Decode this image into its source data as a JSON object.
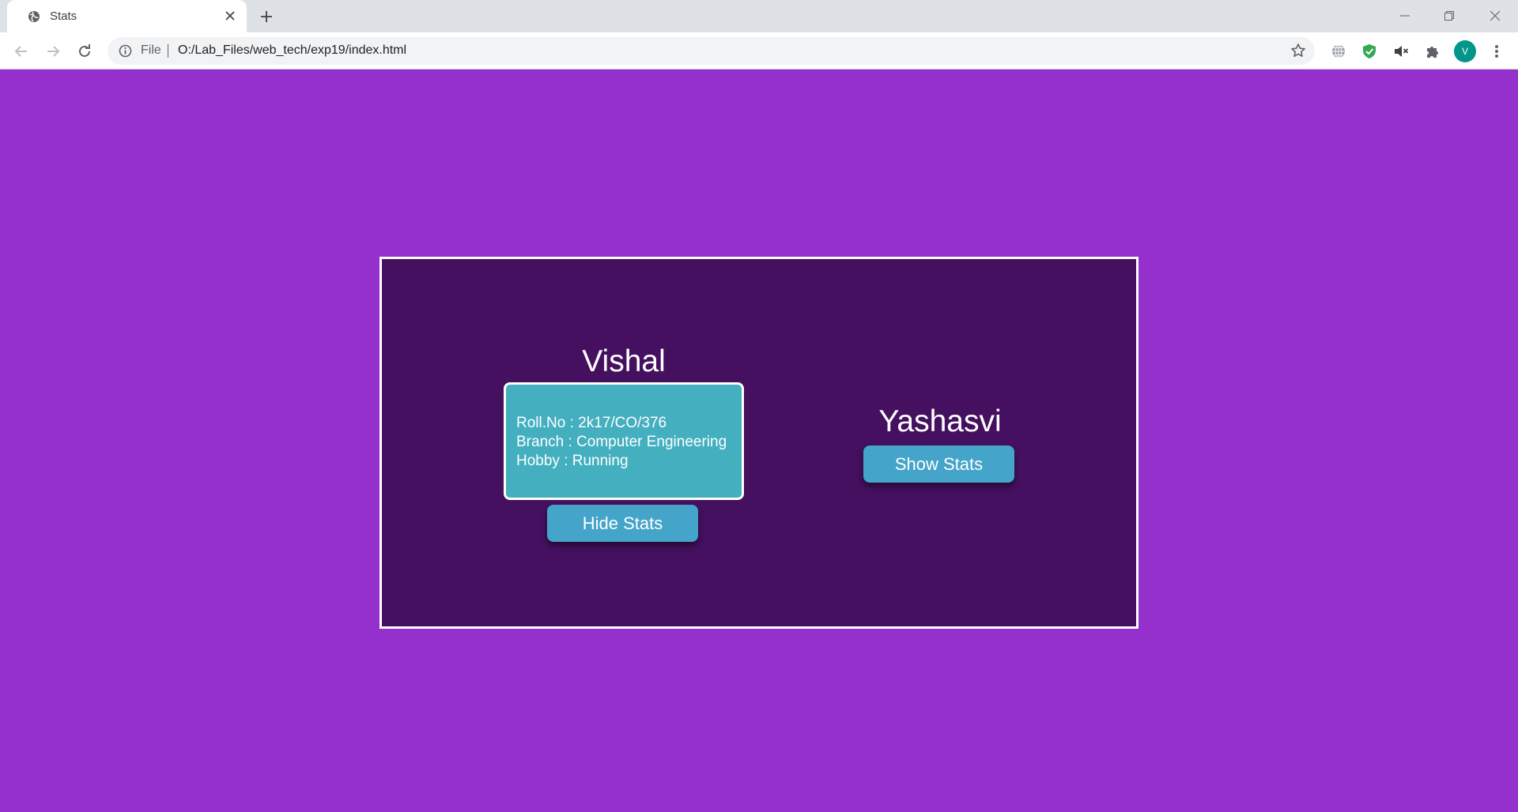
{
  "browser": {
    "tab_title": "Stats",
    "url_scheme": "File",
    "url": "O:/Lab_Files/web_tech/exp19/index.html",
    "profile_initial": "V",
    "icons": [
      "globe-icon",
      "close-icon",
      "plus-icon",
      "back-icon",
      "forward-icon",
      "reload-icon",
      "info-icon",
      "star-icon",
      "translate-icon",
      "shield-icon",
      "mute-icon",
      "puzzle-icon",
      "menu-icon"
    ]
  },
  "page": {
    "background": "#9630cd",
    "panel_color": "#44105f",
    "people": [
      {
        "name": "Vishal",
        "stats_visible": true,
        "stats": [
          "Roll.No : 2k17/CO/376",
          "Branch : Computer Engineering",
          "Hobby : Running"
        ],
        "button_label": "Hide Stats"
      },
      {
        "name": "Yashasvi",
        "stats_visible": false,
        "button_label": "Show Stats"
      }
    ]
  }
}
